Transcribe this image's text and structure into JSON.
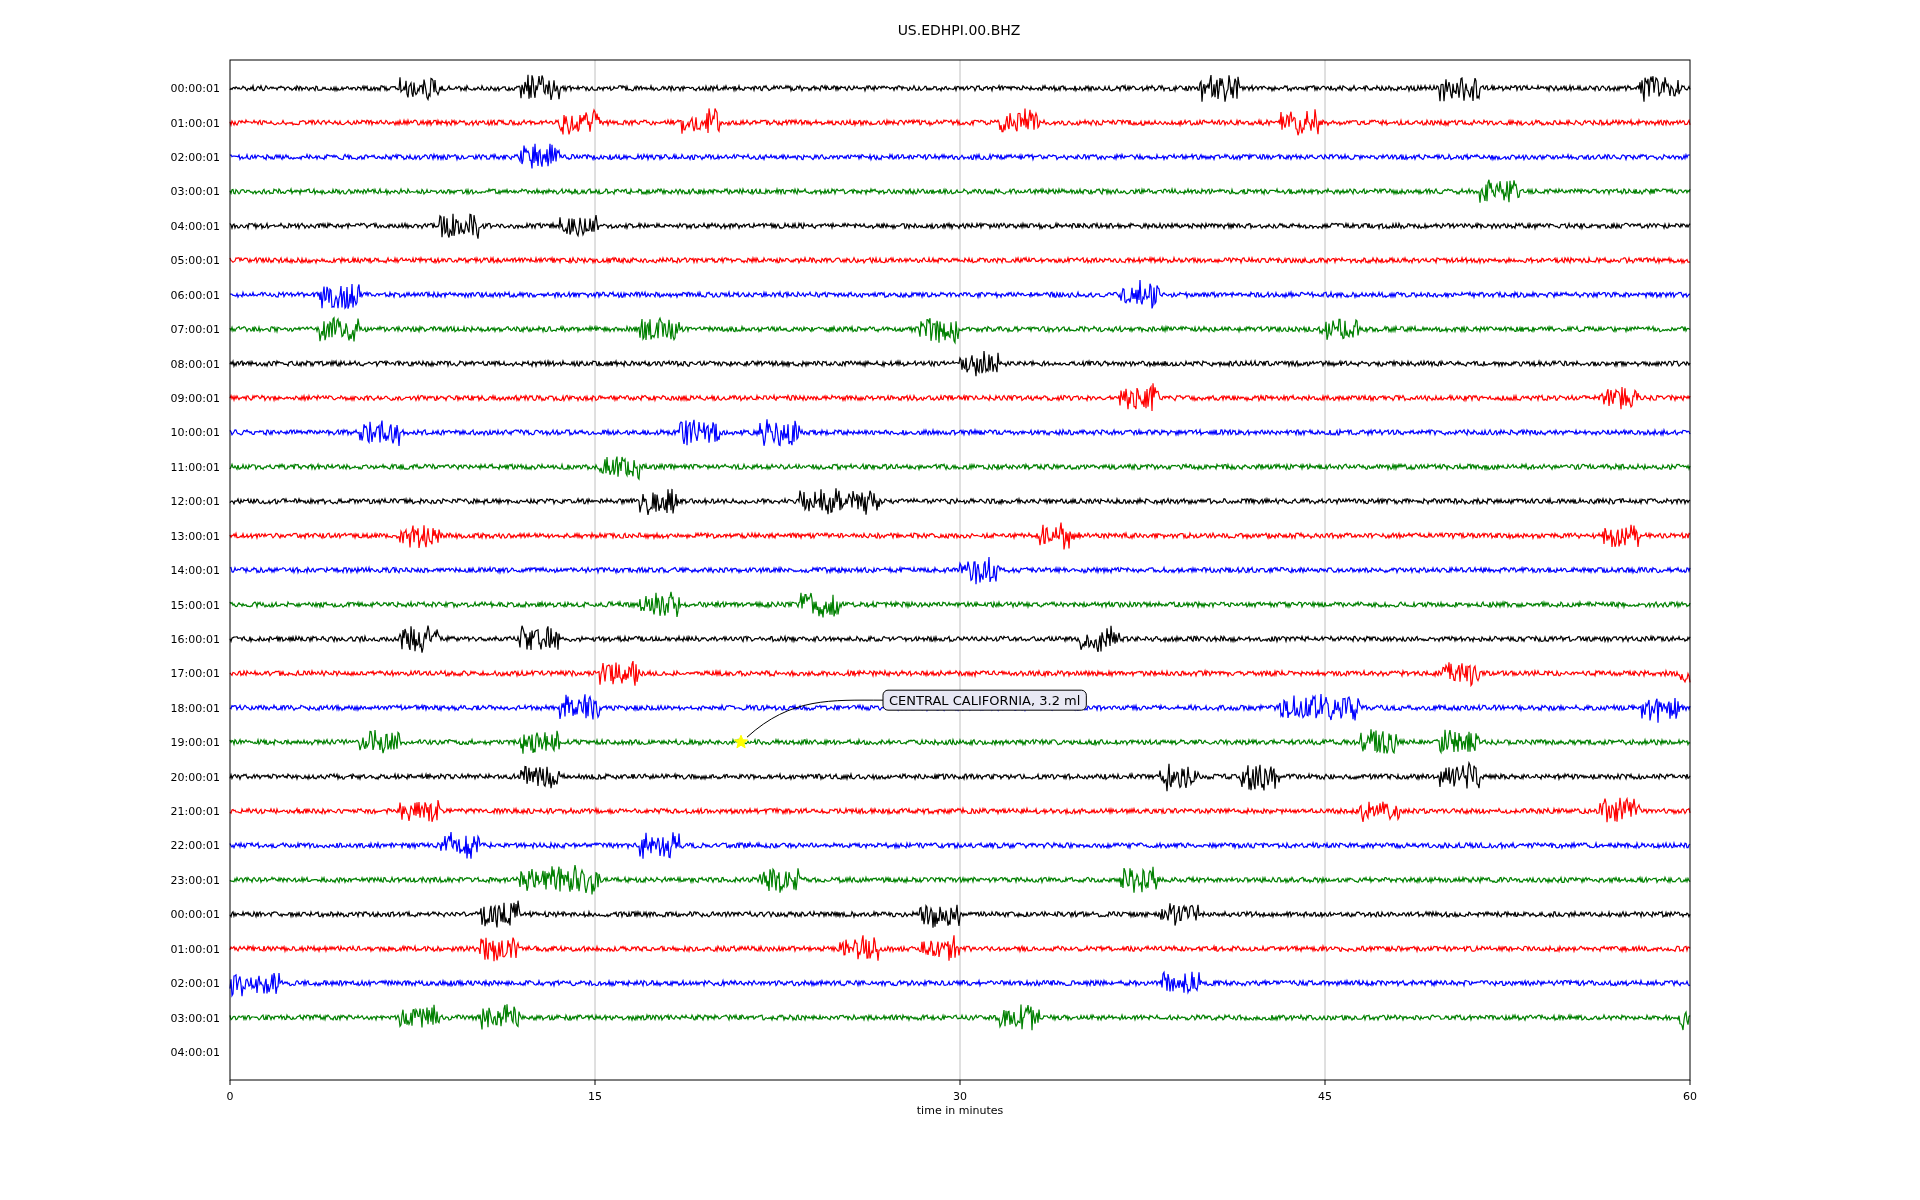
{
  "title": "US.EDHPI.00.BHZ",
  "rows": [
    {
      "label": "00:00:01",
      "color": "#000000"
    },
    {
      "label": "01:00:01",
      "color": "#ff0000"
    },
    {
      "label": "02:00:01",
      "color": "#0000ff"
    },
    {
      "label": "03:00:01",
      "color": "#008000"
    },
    {
      "label": "04:00:01",
      "color": "#000000"
    },
    {
      "label": "05:00:01",
      "color": "#ff0000"
    },
    {
      "label": "06:00:01",
      "color": "#0000ff"
    },
    {
      "label": "07:00:01",
      "color": "#008000"
    },
    {
      "label": "08:00:01",
      "color": "#000000"
    },
    {
      "label": "09:00:01",
      "color": "#ff0000"
    },
    {
      "label": "10:00:01",
      "color": "#0000ff"
    },
    {
      "label": "11:00:01",
      "color": "#008000"
    },
    {
      "label": "12:00:01",
      "color": "#000000"
    },
    {
      "label": "13:00:01",
      "color": "#ff0000"
    },
    {
      "label": "14:00:01",
      "color": "#0000ff"
    },
    {
      "label": "15:00:01",
      "color": "#008000"
    },
    {
      "label": "16:00:01",
      "color": "#000000"
    },
    {
      "label": "17:00:01",
      "color": "#ff0000"
    },
    {
      "label": "18:00:01",
      "color": "#0000ff"
    },
    {
      "label": "19:00:01",
      "color": "#008000"
    },
    {
      "label": "20:00:01",
      "color": "#000000"
    },
    {
      "label": "21:00:01",
      "color": "#ff0000"
    },
    {
      "label": "22:00:01",
      "color": "#0000ff"
    },
    {
      "label": "23:00:01",
      "color": "#008000"
    },
    {
      "label": "00:00:01",
      "color": "#000000"
    },
    {
      "label": "01:00:01",
      "color": "#ff0000"
    },
    {
      "label": "02:00:01",
      "color": "#0000ff"
    },
    {
      "label": "03:00:01",
      "color": "#008000"
    },
    {
      "label": "04:00:01"
    }
  ],
  "xticks": [
    "0",
    "15",
    "30",
    "45",
    "60"
  ],
  "xlabel": "time in minutes",
  "event": {
    "label": "CENTRAL CALIFORNIA, 3.2 ml"
  }
}
